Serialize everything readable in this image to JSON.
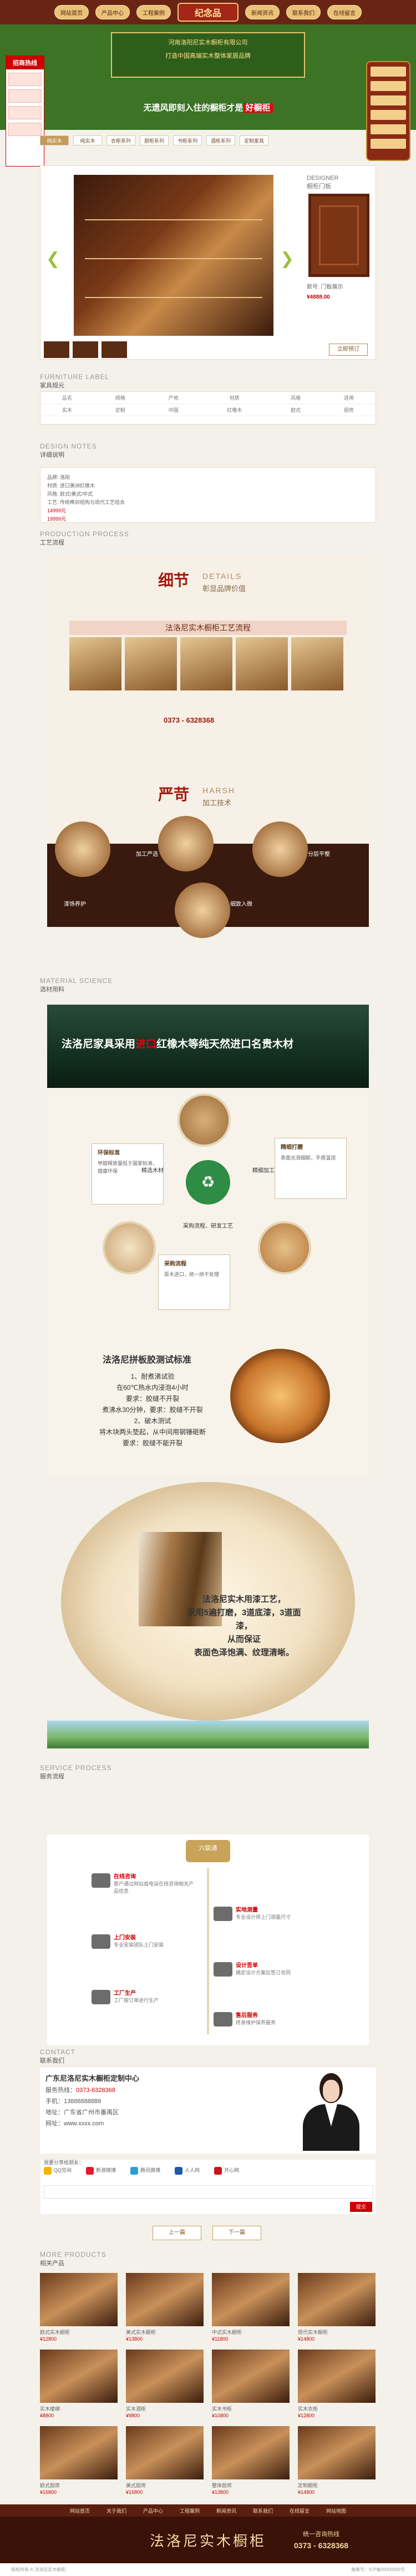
{
  "top_nav": {
    "items": [
      "网站首页",
      "产品中心",
      "工程案例",
      "logo",
      "新闻资讯",
      "联系我们",
      "在线留言"
    ],
    "logo": "纪念品"
  },
  "hero": {
    "banner_line1": "河南洛阳尼实木橱柜有限公司",
    "banner_line2": "打造中国高端实木整体家居品牌",
    "slogan_prefix": "无遗风即刻入住的橱柜才是",
    "slogan_highlight": "好橱柜"
  },
  "left_float": {
    "title": "招商热线"
  },
  "tabs": [
    "纯实木",
    "纯实木",
    "衣柜系列",
    "厨柜系列",
    "书柜系列",
    "酒柜系列",
    "定制家具"
  ],
  "product": {
    "designer_en": "DESIGNER",
    "designer_cn": "橱柜门板",
    "info_name": "款号: 门板展示",
    "price_label": "¥4888.00",
    "price_btn": "立即预订"
  },
  "furniture_label": {
    "en": "FURNITURE LABEL",
    "cn": "家具规元"
  },
  "table": {
    "rows": [
      [
        "品名",
        "规格",
        "产地",
        "材质",
        "风格",
        "适用"
      ],
      [
        "实木",
        "定制",
        "中国",
        "红橡木",
        "欧式",
        "厨房"
      ]
    ]
  },
  "design_notes": {
    "en": "DESIGN NOTES",
    "cn": "详细说明",
    "lines": [
      "品牌: 洛阳",
      "材质: 进口美洲红橡木",
      "风格: 欧式/美式/中式",
      "工艺: 传统榫卯结构与现代工艺结合",
      "交货期: 30-45天",
      "联系电话: 0373-6328368"
    ],
    "red1": "14999元",
    "red2": "19999元"
  },
  "process": {
    "en": "PRODUCTION PROCESS",
    "cn": "工艺流程",
    "title1": "细节",
    "title1_en": "DETAILS",
    "title1_sub": "彰显品牌价值",
    "band1": "法洛尼实木橱柜工艺流程",
    "phone": "0373 - 6328368",
    "title2": "严苛",
    "title2_en": "HARSH",
    "title2_sub": "加工技术",
    "c1": "加工严选",
    "c2": "分层平整",
    "c3": "漆饰养护",
    "c4": "细致入微"
  },
  "material": {
    "en": "MATERIAL SCIENCE",
    "cn": "选材用料",
    "headline_a": "法洛尼家具采用",
    "headline_hl": "进口",
    "headline_b": "红橡木等纯天然进口名贵木材",
    "box1_t": "环保标准",
    "box1": "甲醛释放量低于国家标准，健康环保",
    "box2_t": "精细打磨",
    "box2": "表面光滑细腻，手感温润",
    "box3_t": "采购流程",
    "box3": "原木进口，统一烘干处理",
    "v1": "精选木材",
    "v2": "精细加工",
    "v3": "采购流程、研发工艺"
  },
  "glue": {
    "title": "法洛尼拼板胶测试标准",
    "body": [
      "1、耐煮沸试验",
      "在60℃热水内浸泡4小时",
      "要求：胶缝不开裂",
      "煮沸水30分钟，要求：胶缝不开裂",
      "2、破木测试",
      "将木块两头垫起，从中间用钢锤砸断",
      "要求：胶缝不能开裂"
    ]
  },
  "ring": {
    "lines": [
      "法洛尼实木用漆工艺，",
      "采用5遍打磨，3道底漆，3道面漆，",
      "从而保证",
      "表面色泽饱满、纹理清晰。"
    ]
  },
  "service": {
    "en": "SERVICE PROCESS",
    "cn": "服务流程",
    "header": "六联通",
    "s1_t": "在线咨询",
    "s1": "客户通过网站或电话在线咨询相关产品信息",
    "s2_t": "实地测量",
    "s2": "专业设计师上门测量尺寸",
    "s3_t": "上门安装",
    "s3": "专业安装团队上门安装",
    "s4_t": "设计签单",
    "s4": "确定设计方案后签订合同",
    "s5_t": "工厂生产",
    "s5": "工厂按订单进行生产",
    "s6_t": "售后服务",
    "s6": "终身维护保养服务"
  },
  "contact": {
    "en": "CONTACT",
    "cn": "联系我们",
    "company": "广东尼洛尼实木橱柜定制中心",
    "phone_label": "服务热线：",
    "phone": "0373-6328368",
    "mobile_label": "手机：",
    "mobile": "13888888888",
    "address": "地址：广东省广州市番禺区",
    "site": "网址：www.xxxx.com"
  },
  "share": {
    "title": "我要分享给朋友：",
    "items": [
      "QQ空间",
      "新浪微博",
      "腾讯微博",
      "人人网",
      "开心网"
    ],
    "submit": "提交"
  },
  "buttons": {
    "prev": "上一篇",
    "next": "下一篇"
  },
  "more": {
    "en": "MORE PRODUCTS",
    "cn": "相关产品",
    "items": [
      {
        "name": "欧式实木橱柜",
        "price": "¥12800"
      },
      {
        "name": "美式实木橱柜",
        "price": "¥13800"
      },
      {
        "name": "中式实木橱柜",
        "price": "¥11800"
      },
      {
        "name": "现代实木橱柜",
        "price": "¥14800"
      },
      {
        "name": "实木楼梯",
        "price": "¥8800"
      },
      {
        "name": "实木酒柜",
        "price": "¥9800"
      },
      {
        "name": "实木书柜",
        "price": "¥10800"
      },
      {
        "name": "实木衣柜",
        "price": "¥12800"
      },
      {
        "name": "欧式厨房",
        "price": "¥16800"
      },
      {
        "name": "美式厨房",
        "price": "¥15800"
      },
      {
        "name": "整体厨房",
        "price": "¥13800"
      },
      {
        "name": "定制橱柜",
        "price": "¥14800"
      }
    ]
  },
  "footer": {
    "nav": [
      "网站首页",
      "关于我们",
      "产品中心",
      "工程案例",
      "新闻资讯",
      "联系我们",
      "在线留言",
      "网站地图"
    ],
    "brand": "法洛尼实木橱柜",
    "hot_label": "统一咨询热线",
    "hot_phone": "0373 - 6328368",
    "copyright": "版权所有 © 法洛尼实木橱柜",
    "icp": "备案号：ICP备00000000号"
  }
}
